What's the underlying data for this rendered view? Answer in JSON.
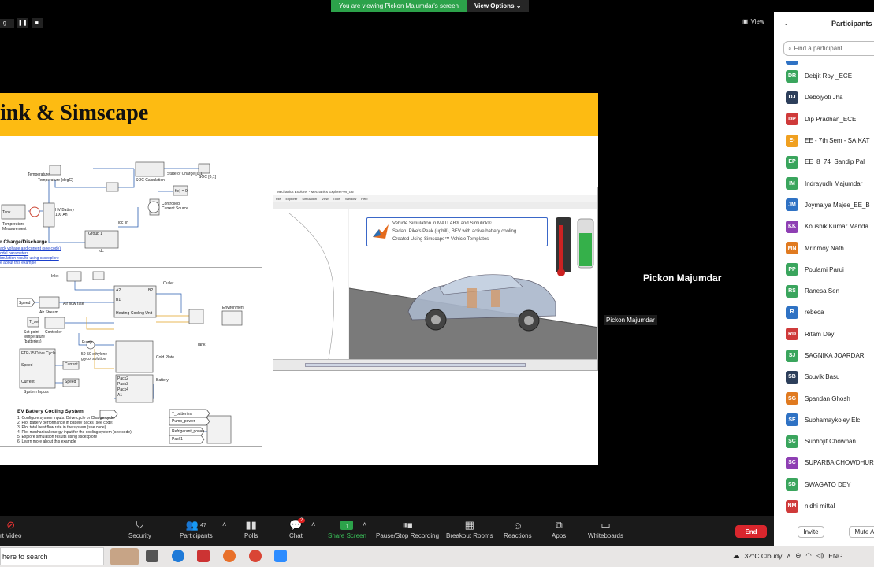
{
  "share_banner": {
    "message": "You are viewing Pickon Majumdar's screen",
    "options_label": "View Options"
  },
  "mini_controls": {
    "label": "g..."
  },
  "view_label": "View",
  "slide": {
    "title": "ink & Simscape",
    "diagram1": {
      "heading": "r Charge/Discharge",
      "links": [
        "ack voltage and current (see code)",
        "odel parameters",
        "imulation results using sscexplore",
        "e about this example"
      ],
      "labels": [
        "Temperature",
        "Temperature (degC)",
        "HV Battery",
        "100 Ah",
        "SOC Calculation",
        "State of Charge [0,1]",
        "SOC [0,1]",
        "f(x) = 0",
        "Controlled Current Source",
        "Idc",
        "Group 1",
        "Tank",
        "Temperature Measurement",
        "idc_in"
      ]
    },
    "diagram2": {
      "heading": "EV Battery Cooling System",
      "items": [
        "1. Configure system inputs: Drive cycle or Charge cycle",
        "2. Plot battery performance in battery packs (see code)",
        "3. Plot total heat flow rate in the system (see code)",
        "4. Plot mechanical energy input for the cooling system (see code)",
        "5. Explore simulation results using sscexplore",
        "6. Learn more about this example"
      ],
      "labels": [
        "Inlet",
        "Outlet",
        "Speed",
        "Air flow rate",
        "Air Stream",
        "Heating-Cooling Unit",
        "Environment",
        "T_set",
        "Controller",
        "Set point temperature (batteries)",
        "Pump",
        "Tank",
        "50-50 ethylene glycol solution",
        "Cold Plate",
        "FTP-75 Drive Cycle",
        "Speed",
        "Current",
        "System Inputs",
        "Battery",
        "Current",
        "Speed",
        "T_batteries",
        "Pump_power",
        "Refrigerant_power",
        "Pack1",
        "Pack2",
        "Pack3",
        "Pack4",
        "A1",
        "A2",
        "B1",
        "B2"
      ]
    }
  },
  "mechanics": {
    "window_title": "Mechanics Explorer - Mechanics Explorer-ev_car",
    "menu": [
      "File",
      "Explorer",
      "Simulation",
      "View",
      "Tools",
      "Window",
      "Help"
    ],
    "info_lines": [
      "Vehicle Simulation in MATLAB® and Simulink®",
      "Sedan, Pike's Peak (uphill), BEV with active battery cooling",
      "Created Using Simscape™ Vehicle Templates"
    ]
  },
  "speaker": {
    "name": "Pickon Majumdar",
    "tag": "Pickon Majumdar"
  },
  "participants": {
    "title": "Participants (",
    "search_placeholder": "Find a participant",
    "list": [
      {
        "initials": "DR",
        "name": "Debjit Roy _ECE",
        "color": "#3aa55d"
      },
      {
        "initials": "DJ",
        "name": "Debojyoti Jha",
        "color": "#2d3f5b"
      },
      {
        "initials": "DP",
        "name": "Dip Pradhan_ECE",
        "color": "#cf3a3a"
      },
      {
        "initials": "E-",
        "name": "EE - 7th Sem - SAIKAT",
        "color": "#f0a020"
      },
      {
        "initials": "EP",
        "name": "EE_8_74_Sandip Pal",
        "color": "#3aa55d"
      },
      {
        "initials": "IM",
        "name": "Indrayudh Majumdar",
        "color": "#3aa55d"
      },
      {
        "initials": "JM",
        "name": "Joymalya Majee_EE_B",
        "color": "#2f72c4"
      },
      {
        "initials": "KK",
        "name": "Koushik Kumar Manda",
        "color": "#8e3fb3"
      },
      {
        "initials": "MN",
        "name": "Mrinmoy Nath",
        "color": "#e07a20"
      },
      {
        "initials": "PP",
        "name": "Poulami Parui",
        "color": "#3aa55d"
      },
      {
        "initials": "RS",
        "name": "Ranesa Sen",
        "color": "#3aa55d"
      },
      {
        "initials": "R",
        "name": "rebeca",
        "color": "#2f72c4"
      },
      {
        "initials": "RD",
        "name": "Ritam Dey",
        "color": "#cf3a3a"
      },
      {
        "initials": "SJ",
        "name": "SAGNIKA JOARDAR",
        "color": "#3aa55d"
      },
      {
        "initials": "SB",
        "name": "Souvik Basu",
        "color": "#2d3f5b"
      },
      {
        "initials": "SG",
        "name": "Spandan Ghosh",
        "color": "#e07a20"
      },
      {
        "initials": "SE",
        "name": "Subhamaykoley Elc",
        "color": "#2f72c4"
      },
      {
        "initials": "SC",
        "name": "Subhojit Chowhan",
        "color": "#3aa55d"
      },
      {
        "initials": "SC",
        "name": "SUPARBA CHOWDHUR",
        "color": "#8e3fb3"
      },
      {
        "initials": "SD",
        "name": "SWAGATO DEY",
        "color": "#3aa55d"
      },
      {
        "initials": "NM",
        "name": "nidhi mittal",
        "color": "#cf3a3a"
      }
    ],
    "invite_label": "Invite",
    "mute_label": "Mute A"
  },
  "toolbar": {
    "video_label": "rt Video",
    "security_label": "Security",
    "participants_label": "Participants",
    "participants_count": "47",
    "polls_label": "Polls",
    "chat_label": "Chat",
    "chat_badge": "2",
    "share_label": "Share Screen",
    "record_label": "Pause/Stop Recording",
    "breakout_label": "Breakout Rooms",
    "reactions_label": "Reactions",
    "apps_label": "Apps",
    "whiteboards_label": "Whiteboards",
    "end_label": "End"
  },
  "taskbar": {
    "search_text": "here to search",
    "weather": "32°C  Cloudy",
    "lang": "ENG"
  }
}
